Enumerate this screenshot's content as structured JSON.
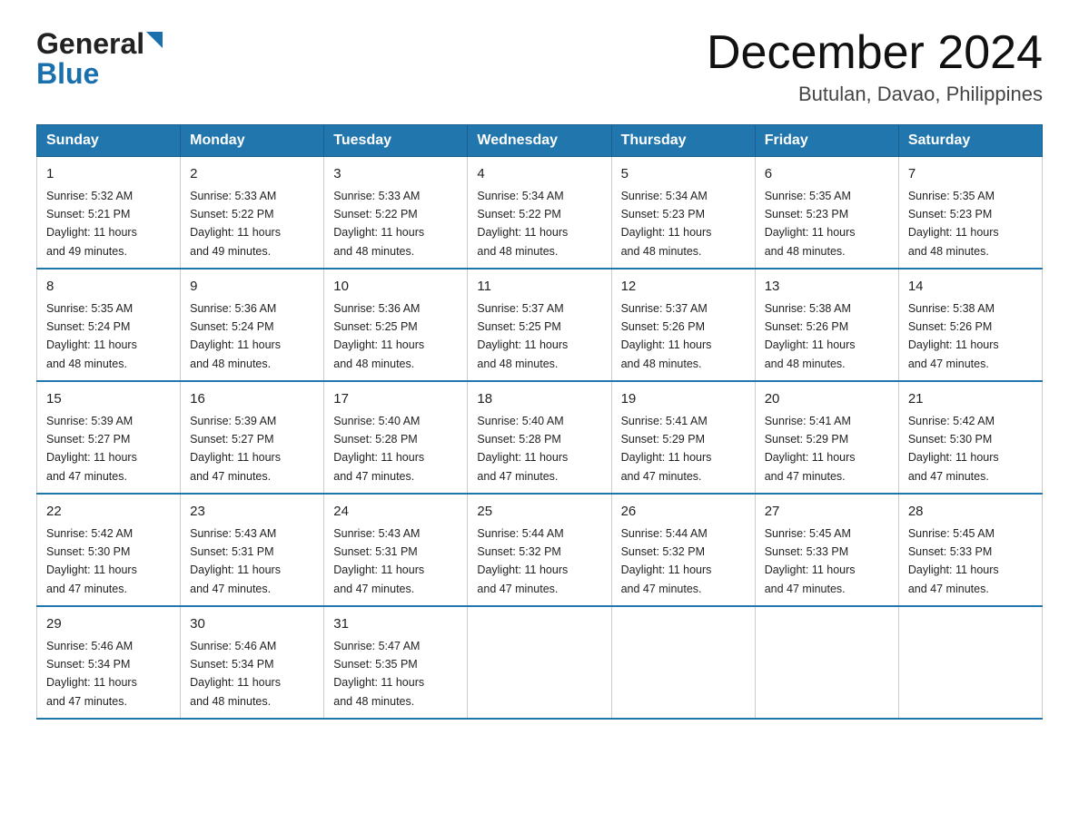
{
  "header": {
    "logo_general": "General",
    "logo_blue": "Blue",
    "month_title": "December 2024",
    "location": "Butulan, Davao, Philippines"
  },
  "days_of_week": [
    "Sunday",
    "Monday",
    "Tuesday",
    "Wednesday",
    "Thursday",
    "Friday",
    "Saturday"
  ],
  "weeks": [
    [
      {
        "day": "1",
        "sunrise": "5:32 AM",
        "sunset": "5:21 PM",
        "daylight": "11 hours and 49 minutes."
      },
      {
        "day": "2",
        "sunrise": "5:33 AM",
        "sunset": "5:22 PM",
        "daylight": "11 hours and 49 minutes."
      },
      {
        "day": "3",
        "sunrise": "5:33 AM",
        "sunset": "5:22 PM",
        "daylight": "11 hours and 48 minutes."
      },
      {
        "day": "4",
        "sunrise": "5:34 AM",
        "sunset": "5:22 PM",
        "daylight": "11 hours and 48 minutes."
      },
      {
        "day": "5",
        "sunrise": "5:34 AM",
        "sunset": "5:23 PM",
        "daylight": "11 hours and 48 minutes."
      },
      {
        "day": "6",
        "sunrise": "5:35 AM",
        "sunset": "5:23 PM",
        "daylight": "11 hours and 48 minutes."
      },
      {
        "day": "7",
        "sunrise": "5:35 AM",
        "sunset": "5:23 PM",
        "daylight": "11 hours and 48 minutes."
      }
    ],
    [
      {
        "day": "8",
        "sunrise": "5:35 AM",
        "sunset": "5:24 PM",
        "daylight": "11 hours and 48 minutes."
      },
      {
        "day": "9",
        "sunrise": "5:36 AM",
        "sunset": "5:24 PM",
        "daylight": "11 hours and 48 minutes."
      },
      {
        "day": "10",
        "sunrise": "5:36 AM",
        "sunset": "5:25 PM",
        "daylight": "11 hours and 48 minutes."
      },
      {
        "day": "11",
        "sunrise": "5:37 AM",
        "sunset": "5:25 PM",
        "daylight": "11 hours and 48 minutes."
      },
      {
        "day": "12",
        "sunrise": "5:37 AM",
        "sunset": "5:26 PM",
        "daylight": "11 hours and 48 minutes."
      },
      {
        "day": "13",
        "sunrise": "5:38 AM",
        "sunset": "5:26 PM",
        "daylight": "11 hours and 48 minutes."
      },
      {
        "day": "14",
        "sunrise": "5:38 AM",
        "sunset": "5:26 PM",
        "daylight": "11 hours and 47 minutes."
      }
    ],
    [
      {
        "day": "15",
        "sunrise": "5:39 AM",
        "sunset": "5:27 PM",
        "daylight": "11 hours and 47 minutes."
      },
      {
        "day": "16",
        "sunrise": "5:39 AM",
        "sunset": "5:27 PM",
        "daylight": "11 hours and 47 minutes."
      },
      {
        "day": "17",
        "sunrise": "5:40 AM",
        "sunset": "5:28 PM",
        "daylight": "11 hours and 47 minutes."
      },
      {
        "day": "18",
        "sunrise": "5:40 AM",
        "sunset": "5:28 PM",
        "daylight": "11 hours and 47 minutes."
      },
      {
        "day": "19",
        "sunrise": "5:41 AM",
        "sunset": "5:29 PM",
        "daylight": "11 hours and 47 minutes."
      },
      {
        "day": "20",
        "sunrise": "5:41 AM",
        "sunset": "5:29 PM",
        "daylight": "11 hours and 47 minutes."
      },
      {
        "day": "21",
        "sunrise": "5:42 AM",
        "sunset": "5:30 PM",
        "daylight": "11 hours and 47 minutes."
      }
    ],
    [
      {
        "day": "22",
        "sunrise": "5:42 AM",
        "sunset": "5:30 PM",
        "daylight": "11 hours and 47 minutes."
      },
      {
        "day": "23",
        "sunrise": "5:43 AM",
        "sunset": "5:31 PM",
        "daylight": "11 hours and 47 minutes."
      },
      {
        "day": "24",
        "sunrise": "5:43 AM",
        "sunset": "5:31 PM",
        "daylight": "11 hours and 47 minutes."
      },
      {
        "day": "25",
        "sunrise": "5:44 AM",
        "sunset": "5:32 PM",
        "daylight": "11 hours and 47 minutes."
      },
      {
        "day": "26",
        "sunrise": "5:44 AM",
        "sunset": "5:32 PM",
        "daylight": "11 hours and 47 minutes."
      },
      {
        "day": "27",
        "sunrise": "5:45 AM",
        "sunset": "5:33 PM",
        "daylight": "11 hours and 47 minutes."
      },
      {
        "day": "28",
        "sunrise": "5:45 AM",
        "sunset": "5:33 PM",
        "daylight": "11 hours and 47 minutes."
      }
    ],
    [
      {
        "day": "29",
        "sunrise": "5:46 AM",
        "sunset": "5:34 PM",
        "daylight": "11 hours and 47 minutes."
      },
      {
        "day": "30",
        "sunrise": "5:46 AM",
        "sunset": "5:34 PM",
        "daylight": "11 hours and 48 minutes."
      },
      {
        "day": "31",
        "sunrise": "5:47 AM",
        "sunset": "5:35 PM",
        "daylight": "11 hours and 48 minutes."
      },
      null,
      null,
      null,
      null
    ]
  ],
  "labels": {
    "sunrise": "Sunrise:",
    "sunset": "Sunset:",
    "daylight": "Daylight:"
  }
}
